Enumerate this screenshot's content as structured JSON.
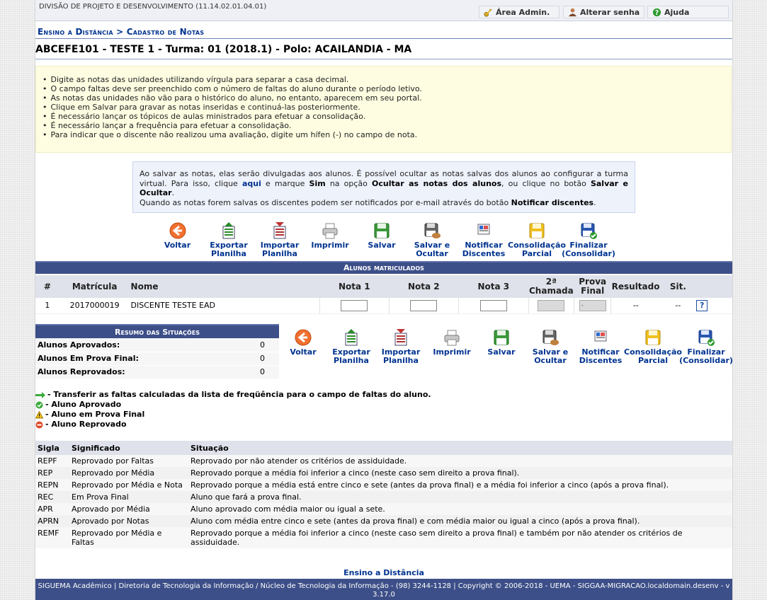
{
  "header": {
    "unit": "DIVISÃO DE PROJETO E DESENVOLVIMENTO (11.14.02.01.04.01)",
    "buttons": {
      "admin": "Área Admin.",
      "password": "Alterar senha",
      "help": "Ajuda"
    }
  },
  "breadcrumb": "Ensino a Distância > Cadastro de Notas",
  "turma": "ABCEFE101 - TESTE 1 - Turma: 01 (2018.1) - Polo: ACAILANDIA - MA",
  "instructions": [
    "Digite as notas das unidades utilizando vírgula para separar a casa decimal.",
    "O campo faltas deve ser preenchido com o número de faltas do aluno durante o período letivo.",
    "As notas das unidades não vão para o histórico do aluno, no entanto, aparecem em seu portal.",
    "Clique em Salvar para gravar as notas inseridas e continuá-las posteriormente.",
    "É necessário lançar os tópicos de aulas ministrados para efetuar a consolidação.",
    "É necessário lançar a frequência para efetuar a consolidação.",
    "Para indicar que o discente não realizou uma avaliação, digite um hífen (-) no campo de nota."
  ],
  "notice": {
    "p1": "Ao salvar as notas, elas serão divulgadas aos alunos. É possível ocultar as notas salvas dos alunos ao configurar a turma virtual. Para isso, clique ",
    "link": "aqui",
    "p2": " e marque ",
    "sim": "Sim",
    "p3": " na opção ",
    "opt": "Ocultar as notas dos alunos",
    "p4": ", ou clique no botão ",
    "btn": "Salvar e Ocultar",
    "p5": ".",
    "p6": "Quando as notas forem salvas os discentes podem ser notificados por e-mail através do botão ",
    "notify": "Notificar discentes",
    "p7": "."
  },
  "toolbar": {
    "voltar": "Voltar",
    "exportar": "Exportar Planilha",
    "importar": "Importar Planilha",
    "imprimir": "Imprimir",
    "salvar": "Salvar",
    "salvar_ocultar": "Salvar e Ocultar",
    "notificar": "Notificar Discentes",
    "consolidacao": "Consolidação Parcial",
    "finalizar": "Finalizar (Consolidar)"
  },
  "alunos": {
    "title": "Alunos matriculados",
    "columns": [
      "#",
      "Matrícula",
      "Nome",
      "Nota 1",
      "Nota 2",
      "Nota 3",
      "2ª Chamada",
      "Prova Final",
      "Resultado",
      "Sit."
    ],
    "rows": [
      {
        "num": "1",
        "matricula": "2017000019",
        "nome": "DISCENTE TESTE EAD",
        "prova_final": "-",
        "resultado": "--",
        "sit": "--"
      }
    ]
  },
  "resumo": {
    "title": "Resumo das Situações",
    "rows": [
      {
        "label": "Alunos Aprovados:",
        "value": "0"
      },
      {
        "label": "Alunos Em Prova Final:",
        "value": "0"
      },
      {
        "label": "Alunos Reprovados:",
        "value": "0"
      }
    ]
  },
  "legend": {
    "transfer": "- Transferir as faltas calculadas da lista de freqüência para o campo de faltas do aluno.",
    "aprovado": "- Aluno Aprovado",
    "prova_final": "- Aluno em Prova Final",
    "reprovado": "- Aluno Reprovado"
  },
  "siglas": {
    "headers": [
      "Sigla",
      "Significado",
      "Situação"
    ],
    "rows": [
      {
        "sigla": "REPF",
        "significado": "Reprovado por Faltas",
        "situacao": "Reprovado por não atender os critérios de assiduidade."
      },
      {
        "sigla": "REP",
        "significado": "Reprovado por Média",
        "situacao": "Reprovado porque a média foi inferior a cinco (neste caso sem direito a prova final)."
      },
      {
        "sigla": "REPN",
        "significado": "Reprovado por Média e Nota",
        "situacao": "Reprovado porque a média está entre cinco e sete (antes da prova final) e a média foi inferior a cinco (após a prova final)."
      },
      {
        "sigla": "REC",
        "significado": "Em Prova Final",
        "situacao": "Aluno que fará a prova final."
      },
      {
        "sigla": "APR",
        "significado": "Aprovado por Média",
        "situacao": "Aluno aprovado com média maior ou igual a sete."
      },
      {
        "sigla": "APRN",
        "significado": "Aprovado por Notas",
        "situacao": "Aluno com média entre cinco e sete (antes da prova final) e com média maior ou igual a cinco (após a prova final)."
      },
      {
        "sigla": "REMF",
        "significado": "Reprovado por Média e Faltas",
        "situacao": "Reprovado porque a média foi inferior a cinco (neste caso sem direito a prova final) e também por não atender os critérios de assiduidade."
      }
    ]
  },
  "bottom_link": "Ensino a Distância",
  "footer": "SIGUEMA Acadêmico | Diretoria de Tecnologia da Informação / Núcleo de Tecnologia da Informação - (98) 3244-1128 | Copyright © 2006-2018 - UEMA - SIGGAA-MIGRACAO.localdomain.desenv - v 3.17.0",
  "colors": {
    "accent": "#003390",
    "bar": "#3d4f88",
    "info_bg": "#fefde1",
    "notice_bg": "#eef2fb"
  }
}
